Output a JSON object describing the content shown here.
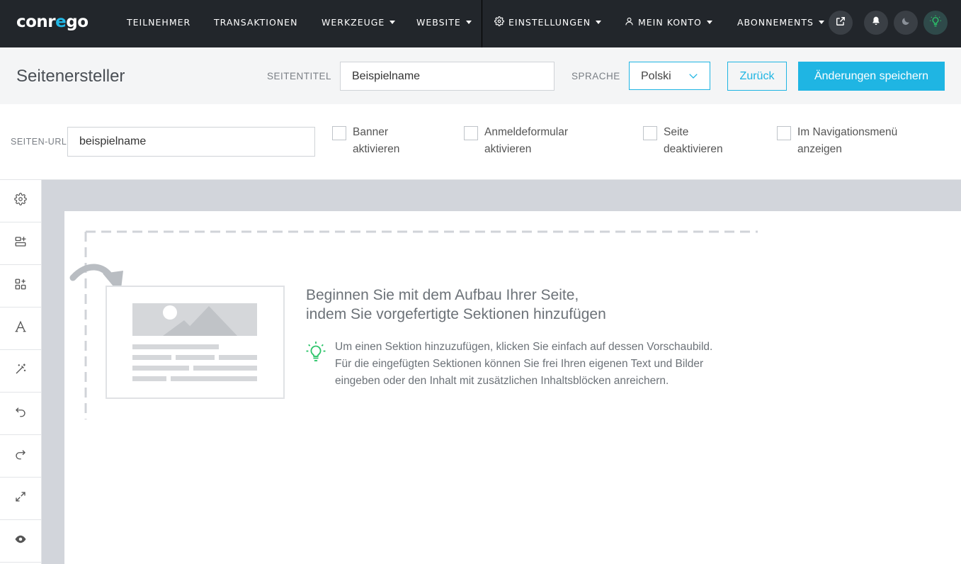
{
  "app": {
    "logo_text_a": "conr",
    "logo_text_b": "e",
    "logo_text_c": "go"
  },
  "nav": {
    "participants": "TEILNEHMER",
    "transactions": "TRANSAKTIONEN",
    "tools": "WERKZEUGE",
    "website": "WEBSITE",
    "settings": "EINSTELLUNGEN",
    "account": "MEIN KONTO",
    "subscriptions": "ABONNEMENTS"
  },
  "header": {
    "title": "Seitenersteller",
    "page_title_label": "SEITENTITEL",
    "page_title_value": "Beispielname",
    "language_label": "SPRACHE",
    "language_value": "Polski",
    "back_label": "Zurück",
    "save_label": "Änderungen speichern"
  },
  "settings": {
    "url_label": "SEITEN-URL",
    "url_value": "beispielname",
    "options": [
      {
        "line1": "Banner",
        "line2": "aktivieren",
        "checked": false
      },
      {
        "line1": "Anmeldeformular",
        "line2": "aktivieren",
        "checked": false
      },
      {
        "line1": "Seite",
        "line2": "deaktivieren",
        "checked": false
      },
      {
        "line1": "Im Navigationsmenü",
        "line2": "anzeigen",
        "checked": false
      }
    ]
  },
  "toolbar": {
    "icons": [
      "gear-icon",
      "add-section-icon",
      "add-block-icon",
      "typography-icon",
      "magic-wand-icon",
      "undo-icon",
      "redo-icon",
      "fullscreen-icon",
      "preview-eye-icon"
    ]
  },
  "canvas": {
    "title_line1": "Beginnen Sie mit dem Aufbau Ihrer Seite,",
    "title_line2": "indem Sie vorgefertigte Sektionen hinzufügen",
    "hint_line1": "Um einen Sektion hinzuzufügen, klicken Sie einfach auf dessen Vorschaubild.",
    "hint_line2": "Für die eingefügten Sektionen können Sie frei Ihren eigenen Text und Bilder",
    "hint_line3": "eingeben oder den Inhalt mit zusätzlichen Inhaltsblöcken anreichern."
  },
  "colors": {
    "accent": "#1fb5e3",
    "nav_bg": "#22262b",
    "hint_green": "#2cc46a"
  }
}
